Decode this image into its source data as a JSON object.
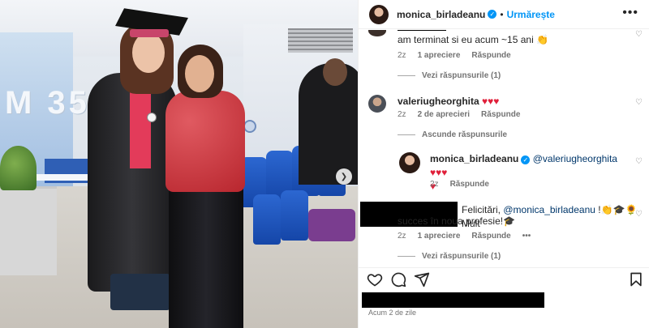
{
  "photo": {
    "wall_text": "M 35",
    "next_icon": "chevron-right-icon"
  },
  "post_header": {
    "username": "monica_birladeanu",
    "separator": "•",
    "follow_label": "Urmărește",
    "more_icon": "more-horizontal-icon"
  },
  "comments": [
    {
      "id": "c1",
      "text": "am terminat si eu acum ~15 ani 👏",
      "time": "2z",
      "likes": "1 apreciere",
      "reply": "Răspunde",
      "view_replies": "Vezi răspunsurile (1)"
    },
    {
      "id": "c2",
      "username": "valeriugheorghita",
      "hearts": "♥♥♥",
      "time": "2z",
      "likes": "2 de aprecieri",
      "reply": "Răspunde",
      "hide_replies": "Ascunde răspunsurile"
    },
    {
      "id": "c2r1",
      "username": "monica_birladeanu",
      "mention": "@valeriugheorghita",
      "hearts_inline": "♥♥♥",
      "hearts_wrap": "♥",
      "time": "2z",
      "reply": "Răspunde"
    },
    {
      "id": "c3",
      "text_prefix": "Felicitări, ",
      "mention": "@monica_birladeanu",
      "text_emojis": " !👏🎓🌻 Mult",
      "text_line2": "succes în noua profesie!🎓",
      "time": "2z",
      "likes": "1 apreciere",
      "reply": "Răspunde",
      "more": "•••",
      "view_replies": "Vezi răspunsurile (1)"
    }
  ],
  "footer": {
    "date": "Acum 2 de zile"
  },
  "colors": {
    "accent": "#0095f6",
    "meta": "#737373",
    "heart_red": "#e0203a",
    "mention": "#00376b"
  }
}
